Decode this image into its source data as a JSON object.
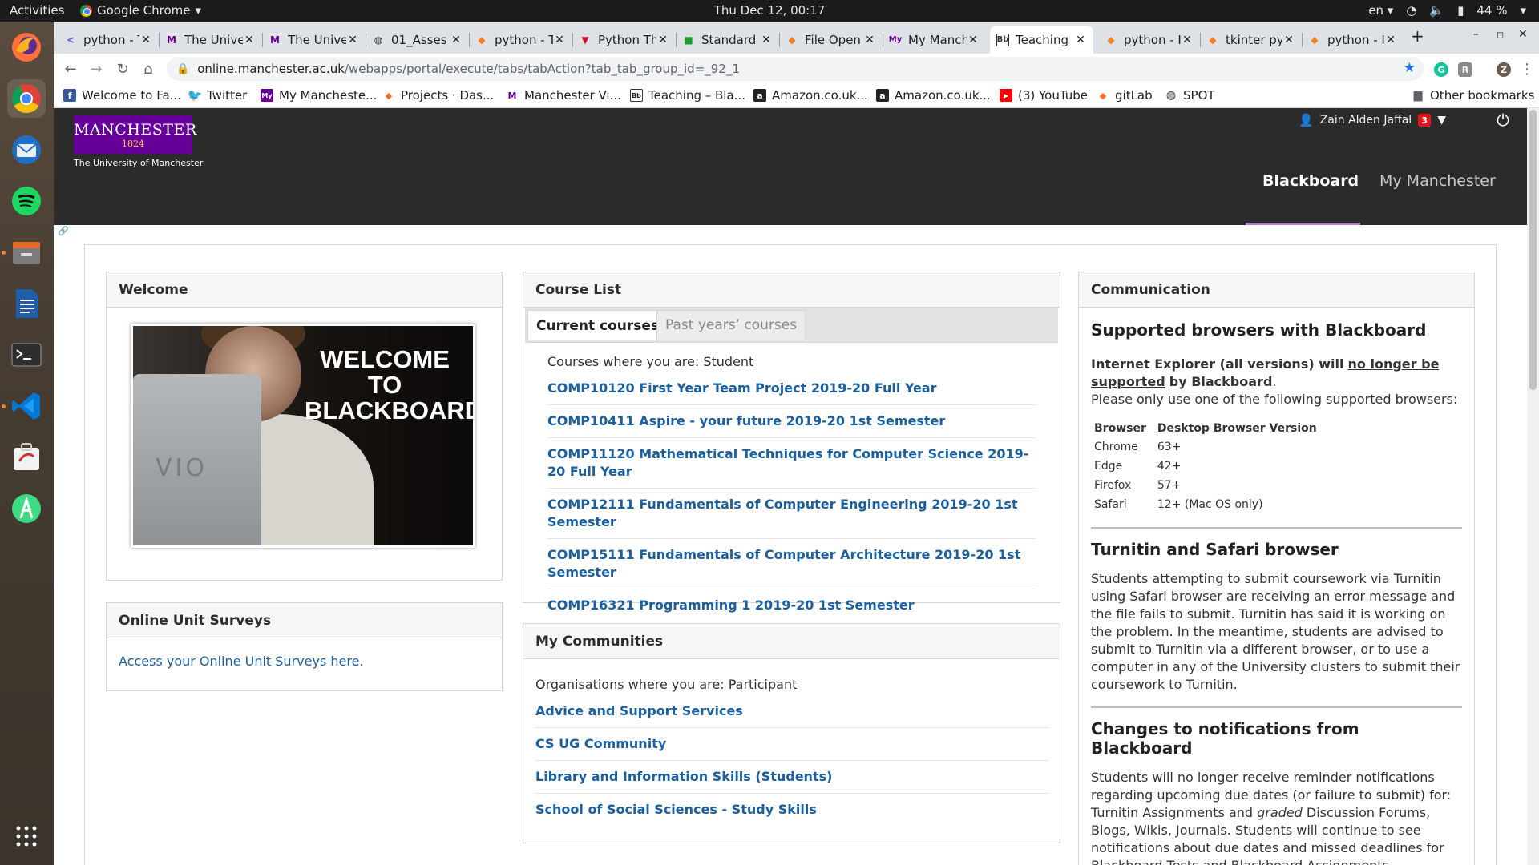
{
  "system": {
    "activities": "Activities",
    "app_name": "Google Chrome",
    "clock": "Thu Dec 12, 00:17",
    "lang": "en",
    "battery": "44 %"
  },
  "dock": {
    "items": [
      "firefox",
      "chrome",
      "thunderbird",
      "spotify",
      "files",
      "libreoffice-writer",
      "terminal",
      "vscode",
      "ubuntu-software",
      "android-studio",
      "show-apps"
    ]
  },
  "tabs": [
    {
      "label": "python - T",
      "icon": "<"
    },
    {
      "label": "The Unive",
      "icon": "M"
    },
    {
      "label": "The Unive",
      "icon": "M"
    },
    {
      "label": "01_Asses",
      "icon": "◍"
    },
    {
      "label": "python - T",
      "icon": "◆"
    },
    {
      "label": "Python Th",
      "icon": "▼"
    },
    {
      "label": "Standard",
      "icon": "■"
    },
    {
      "label": "File Open",
      "icon": "◆"
    },
    {
      "label": "My Manch",
      "icon": "My"
    },
    {
      "label": "Teaching",
      "icon": "Bb"
    },
    {
      "label": "python - I",
      "icon": "◆"
    },
    {
      "label": "tkinter py",
      "icon": "◆"
    },
    {
      "label": "python - I",
      "icon": "◆"
    }
  ],
  "address": {
    "host": "online.manchester.ac.uk",
    "path": "/webapps/portal/execute/tabs/tabAction?tab_tab_group_id=_92_1"
  },
  "bookmarks": [
    {
      "label": "Welcome to Fa..."
    },
    {
      "label": "Twitter"
    },
    {
      "label": "My Mancheste..."
    },
    {
      "label": "Projects · Das..."
    },
    {
      "label": "Manchester Vi..."
    },
    {
      "label": "Teaching – Bla..."
    },
    {
      "label": "Amazon.co.uk..."
    },
    {
      "label": "Amazon.co.uk..."
    },
    {
      "label": "(3) YouTube"
    },
    {
      "label": "gitLab"
    },
    {
      "label": "SPOT"
    }
  ],
  "other_bookmarks": "Other bookmarks",
  "header": {
    "logo_line1": "MANCHESTER",
    "logo_line2": "1824",
    "logo_sub": "The University of Manchester",
    "user_name": "Zain Alden Jaffal",
    "notifications": "3",
    "nav": [
      "Blackboard",
      "My Manchester"
    ]
  },
  "welcome": {
    "title": "Welcome",
    "image_text": [
      "WELCOME",
      "TO",
      "BLACKBOARD"
    ]
  },
  "surveys": {
    "title": "Online Unit Surveys",
    "link": "Access your Online Unit Surveys here."
  },
  "course_list": {
    "title": "Course List",
    "tab_current": "Current courses",
    "tab_past": "Past years’ courses",
    "role": "Courses where you are: Student",
    "courses": [
      "COMP10120 First Year Team Project 2019-20 Full Year",
      "COMP10411 Aspire - your future 2019-20 1st Semester",
      "COMP11120 Mathematical Techniques for Computer Science 2019-20 Full Year",
      "COMP12111 Fundamentals of Computer Engineering 2019-20 1st Semester",
      "COMP15111 Fundamentals of Computer Architecture 2019-20 1st Semester",
      "COMP16321 Programming 1 2019-20 1st Semester"
    ]
  },
  "communities": {
    "title": "My Communities",
    "role": "Organisations where you are: Participant",
    "items": [
      "Advice and Support Services",
      "CS UG Community",
      "Library and Information Skills (Students)",
      "School of Social Sciences - Study Skills"
    ]
  },
  "communication": {
    "title": "Communication",
    "h_browsers": "Supported browsers with Blackboard",
    "ie_bold": "Internet Explorer (all versions) will",
    "ie_underline1": "no longer be",
    "ie_underline2": "supported",
    "ie_tail": "by Blackboard",
    "ie_period": ".",
    "please": "Please only use one of the following supported browsers:",
    "table_head": [
      "Browser",
      "Desktop Browser Version"
    ],
    "table_rows": [
      [
        "Chrome",
        "63+"
      ],
      [
        "Edge",
        "42+"
      ],
      [
        "Firefox",
        "57+"
      ],
      [
        "Safari",
        "12+ (Mac OS only)"
      ]
    ],
    "h_turnitin": "Turnitin and Safari browser",
    "turnitin_text": "Students attempting to submit coursework via Turnitin using Safari browser are receiving an error message and the file fails to submit. Turnitin has said it is working on the problem. In the meantime, students are advised to submit to Turnitin via a different browser, or to use a computer in any of the University clusters to submit their coursework to Turnitin.",
    "h_notifications": "Changes to notifications from Blackboard",
    "notif_text_1": "Students will no longer receive reminder notifications regarding upcoming due dates (or failure to submit) for: Turnitin Assignments and ",
    "notif_italic": "graded",
    "notif_text_2": " Discussion Forums, Blogs, Wikis, Journals. Students will continue to see notifications about due dates and missed deadlines for Blackboard Tests and Blackboard Assignments. Notifications have been"
  }
}
